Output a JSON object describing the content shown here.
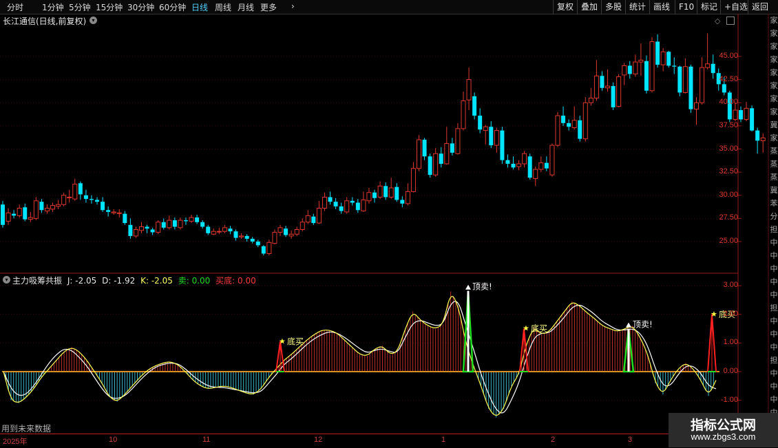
{
  "toolbar": {
    "periods": [
      "分时",
      "1分钟",
      "5分钟",
      "15分钟",
      "30分钟",
      "60分钟",
      "日线",
      "周线",
      "月线",
      "更多"
    ],
    "active_index": 6,
    "more_arrow": "›",
    "right_items": [
      "复权",
      "叠加",
      "多股",
      "统计",
      "画线",
      "F10",
      "标记",
      "+自选",
      "返回"
    ]
  },
  "stock_title": "长江通信(日线,前复权)",
  "price_axis": [
    "45.00",
    "42.50",
    "40.00",
    "37.50",
    "35.00",
    "32.50",
    "30.00",
    "27.50",
    "25.00"
  ],
  "indicator": {
    "name": "主力吸筹共振",
    "j": "J: -2.05",
    "d": "D: -1.92",
    "k": "K: -2.05",
    "sell_label": "卖:",
    "sell_value": "0.00",
    "buy_label": "买底:",
    "buy_value": "0.00",
    "axis": [
      "3.00",
      "2.00",
      "1.00",
      "0.00",
      "-1.00"
    ],
    "signals": [
      {
        "text": "底买",
        "kind": "buy"
      },
      {
        "text": "顶卖!",
        "kind": "sell"
      },
      {
        "text": "底买",
        "kind": "buy"
      },
      {
        "text": "顶卖!",
        "kind": "sell"
      },
      {
        "text": "底买",
        "kind": "buy"
      }
    ]
  },
  "right_strip": [
    "家",
    "家",
    "家",
    "家",
    "家",
    "家",
    "家",
    "家",
    "冀",
    "家",
    "蒸",
    "蒸",
    "蒸",
    "冀",
    "苯",
    "分",
    "担",
    "中",
    "中",
    "中",
    "中",
    "中",
    "担",
    "中",
    "中",
    "中",
    "担",
    "中",
    "中",
    "中",
    "中"
  ],
  "future_note": "用到未来数据",
  "dates": [
    "2025年",
    "10",
    "11",
    "12",
    "1",
    "2",
    "3"
  ],
  "watermark": {
    "title": "指标公式网",
    "url": "www.zbgs3.com"
  },
  "colors": {
    "up": "#e0382e",
    "down": "#00e5ff",
    "grid": "#7a1010",
    "active": "#4fd0ff"
  },
  "chart_data": [
    {
      "type": "candlestick",
      "title": "长江通信(日线,前复权)",
      "y_axis_ticks": [
        25.0,
        27.5,
        30.0,
        32.5,
        35.0,
        37.5,
        40.0,
        42.5,
        45.0
      ],
      "x_ticks": [
        "2025年",
        "10",
        "11",
        "12",
        "1",
        "2",
        "3"
      ],
      "candles": [
        [
          29,
          26.8,
          29.4,
          26.5
        ],
        [
          27.2,
          28.1,
          28.6,
          26.8
        ],
        [
          28,
          27.8,
          28.4,
          27.5
        ],
        [
          27.8,
          28.6,
          29,
          27.6
        ],
        [
          28.7,
          27.4,
          29.1,
          27.2
        ],
        [
          27.4,
          27.6,
          28.2,
          27.1
        ],
        [
          27.5,
          29.4,
          29.8,
          27.3
        ],
        [
          29.3,
          28.4,
          29.6,
          28.1
        ],
        [
          28.3,
          28.6,
          29,
          28
        ],
        [
          28.5,
          28.9,
          29.2,
          28.2
        ],
        [
          28.8,
          29,
          29.5,
          28.5
        ],
        [
          29,
          30,
          30.3,
          28.8
        ],
        [
          29.8,
          29.8,
          30.6,
          29.2
        ],
        [
          29.6,
          31.2,
          31.8,
          29.4
        ],
        [
          31.3,
          30.1,
          31.5,
          29.5
        ],
        [
          30,
          29.6,
          30.6,
          29.2
        ],
        [
          29.6,
          29.5,
          30,
          29.1
        ],
        [
          29.5,
          29.3,
          29.8,
          29
        ],
        [
          29.3,
          28.4,
          29.8,
          28.2
        ],
        [
          28.4,
          28.2,
          28.8,
          27.7
        ],
        [
          28.1,
          28.2,
          28.5,
          27.9
        ],
        [
          28.1,
          28.1,
          28.5,
          27.6
        ],
        [
          28,
          27,
          28.3,
          26.8
        ],
        [
          26.8,
          25.6,
          27.5,
          25.3
        ],
        [
          25.6,
          26.3,
          26.6,
          25.4
        ],
        [
          26.2,
          26.6,
          27.1,
          25.9
        ],
        [
          26.6,
          26.4,
          26.8,
          25.9
        ],
        [
          26.3,
          26,
          26.5,
          25.7
        ],
        [
          26,
          27.1,
          27.3,
          25.8
        ],
        [
          27.1,
          26.5,
          27.5,
          26.3
        ],
        [
          26.5,
          27.3,
          27.8,
          26.3
        ],
        [
          27.3,
          26.6,
          27.6,
          26.3
        ],
        [
          26.5,
          27.3,
          27.6,
          26.3
        ],
        [
          27.3,
          27.2,
          27.6,
          26.8
        ],
        [
          27.2,
          27.6,
          27.9,
          27
        ],
        [
          27.6,
          27.1,
          27.9,
          26.9
        ],
        [
          27.1,
          26.6,
          27.3,
          26.4
        ],
        [
          26.6,
          25.9,
          26.8,
          25.7
        ],
        [
          25.8,
          26.1,
          26.4,
          25.7
        ],
        [
          26.1,
          26.1,
          26.5,
          25.8
        ],
        [
          26.1,
          26.5,
          26.8,
          25.9
        ],
        [
          26.4,
          26.1,
          26.7,
          25.8
        ],
        [
          26.1,
          25.4,
          26.3,
          25.1
        ],
        [
          25.5,
          25.6,
          25.9,
          25.3
        ],
        [
          25.6,
          25.3,
          25.8,
          25
        ],
        [
          25.3,
          25,
          25.5,
          24.8
        ],
        [
          25,
          24.6,
          25.2,
          24.4
        ],
        [
          24.5,
          23.7,
          24.6,
          23.5
        ],
        [
          23.7,
          24.9,
          25.2,
          23.5
        ],
        [
          24.8,
          26,
          26.3,
          24.7
        ],
        [
          26,
          26.5,
          26.8,
          25.6
        ],
        [
          26.4,
          25.7,
          26.7,
          25.5
        ],
        [
          25.6,
          25.8,
          26.2,
          25.3
        ],
        [
          25.8,
          26.3,
          26.6,
          25.6
        ],
        [
          26.3,
          27.1,
          27.5,
          26.1
        ],
        [
          27.1,
          27.8,
          28.4,
          26.9
        ],
        [
          27.7,
          27,
          28,
          26.8
        ],
        [
          27,
          28.6,
          29.4,
          26.9
        ],
        [
          28.6,
          29.8,
          30.3,
          28.3
        ],
        [
          29.8,
          29.3,
          30.4,
          29
        ],
        [
          29.3,
          28.8,
          29.7,
          28.5
        ],
        [
          28.8,
          28.3,
          29.2,
          28
        ],
        [
          28.2,
          29.4,
          29.8,
          28
        ],
        [
          29.4,
          29.2,
          29.8,
          28.9
        ],
        [
          29.2,
          28.4,
          29.6,
          28.1
        ],
        [
          28.3,
          29.5,
          30.4,
          28.2
        ],
        [
          29.4,
          30.3,
          30.8,
          29.1
        ],
        [
          30.3,
          29.7,
          30.6,
          29.2
        ],
        [
          29.8,
          31,
          31.5,
          29.6
        ],
        [
          31,
          29.8,
          31.4,
          29.5
        ],
        [
          29.8,
          30.8,
          31.9,
          29.6
        ],
        [
          30.9,
          29.5,
          31.3,
          29.3
        ],
        [
          29.5,
          29.1,
          29.9,
          28.7
        ],
        [
          29.1,
          30.4,
          31.3,
          28.9
        ],
        [
          30.4,
          32.9,
          33.6,
          30.3
        ],
        [
          32.9,
          36,
          36.5,
          32.6
        ],
        [
          36,
          34.2,
          36.2,
          33.8
        ],
        [
          34.2,
          32.2,
          34.5,
          31.9
        ],
        [
          32.2,
          34.5,
          35.1,
          32
        ],
        [
          34.5,
          33.4,
          35.2,
          33
        ],
        [
          33.4,
          35.6,
          37.4,
          33.3
        ],
        [
          35.6,
          34.6,
          36.2,
          34.3
        ],
        [
          34.5,
          37.2,
          37.8,
          34.4
        ],
        [
          37.2,
          40.2,
          41.2,
          37
        ],
        [
          40.3,
          42.5,
          43.8,
          39.2
        ],
        [
          40.7,
          38.6,
          41.1,
          38.2
        ],
        [
          38.6,
          37.1,
          39.4,
          36.7
        ],
        [
          37,
          37.4,
          37.6,
          35.5
        ],
        [
          37.4,
          35.4,
          38,
          35.1
        ],
        [
          35.4,
          37,
          37.3,
          34.6
        ],
        [
          37,
          33.8,
          37.4,
          33.4
        ],
        [
          33.8,
          33.4,
          34.4,
          33
        ],
        [
          33.4,
          33,
          34.2,
          32.8
        ],
        [
          33.1,
          33.4,
          33.8,
          32.7
        ],
        [
          33.4,
          34.5,
          34.8,
          33
        ],
        [
          34.2,
          31.9,
          34.5,
          31.7
        ],
        [
          31.8,
          32.8,
          33.1,
          31
        ],
        [
          32.8,
          33.5,
          34.2,
          32.5
        ],
        [
          33.5,
          32.9,
          34.2,
          32.6
        ],
        [
          32.2,
          35.4,
          35.6,
          32
        ],
        [
          35.4,
          38.6,
          39,
          35.2
        ],
        [
          38.6,
          37.8,
          39.6,
          37.5
        ],
        [
          37.8,
          37.4,
          38.2,
          37
        ],
        [
          37.3,
          38.1,
          39.6,
          37.1
        ],
        [
          38.1,
          36.1,
          38.6,
          35.8
        ],
        [
          36.1,
          40,
          40.6,
          35.8
        ],
        [
          40,
          40.5,
          41.6,
          39.7
        ],
        [
          40.5,
          42.9,
          44.6,
          40.2
        ],
        [
          42.9,
          41.6,
          43.4,
          41.3
        ],
        [
          41.6,
          41.8,
          43.6,
          41.2
        ],
        [
          41.8,
          39.5,
          42.2,
          39.2
        ],
        [
          39.6,
          42.8,
          43.1,
          39.5
        ],
        [
          43,
          44,
          44.3,
          41.9
        ],
        [
          44,
          43.1,
          44.5,
          42.6
        ],
        [
          43.1,
          44.4,
          45.2,
          42.8
        ],
        [
          44.4,
          44.6,
          46.4,
          42.9
        ],
        [
          44.5,
          41.3,
          45.1,
          41
        ],
        [
          41.3,
          46.6,
          47.1,
          41.1
        ],
        [
          46.6,
          44.1,
          47.4,
          43.8
        ],
        [
          44.1,
          45.5,
          45.9,
          43.4
        ],
        [
          45.5,
          44,
          45.6,
          43.8
        ],
        [
          44,
          43.9,
          44.9,
          43.1
        ],
        [
          43.9,
          41.1,
          44,
          40.7
        ],
        [
          41.1,
          43.9,
          44.8,
          41
        ],
        [
          43.9,
          39.3,
          44.1,
          38.9
        ],
        [
          39.3,
          40,
          40.6,
          37.6
        ],
        [
          40,
          43.8,
          44.9,
          39.8
        ],
        [
          43.8,
          44.2,
          47.5,
          43.6
        ],
        [
          44.2,
          43.2,
          45.2,
          42.6
        ],
        [
          43.2,
          42,
          43.7,
          41.3
        ],
        [
          42,
          41.1,
          42.8,
          40.8
        ],
        [
          41.1,
          38.2,
          41.3,
          37.9
        ],
        [
          38.2,
          39.2,
          40,
          38
        ],
        [
          39.2,
          38.2,
          39.6,
          37.9
        ],
        [
          38.2,
          39.4,
          40.1,
          38
        ],
        [
          39.4,
          37,
          39.7,
          36.9
        ],
        [
          37,
          35.9,
          37.3,
          34.5
        ],
        [
          35.9,
          36.2,
          36.7,
          34.6
        ]
      ]
    },
    {
      "type": "line",
      "title": "主力吸筹共振",
      "y_axis_ticks": [
        -1.0,
        0.0,
        1.0,
        2.0,
        3.0
      ],
      "series": [
        {
          "name": "J",
          "color": "#ffff55"
        },
        {
          "name": "D",
          "color": "#ffffff"
        },
        {
          "name": "K",
          "color": "#ffffcc"
        }
      ],
      "fast": [
        0,
        -1,
        -1.1,
        -0.9,
        -0.6,
        -0.2,
        0.1,
        0.4,
        0.7,
        0.85,
        0.7,
        0.4,
        0,
        -0.4,
        -0.9,
        -1.05,
        -0.8,
        -0.5,
        -0.2,
        0.05,
        0.2,
        0.3,
        0.35,
        0.25,
        0,
        -0.3,
        -0.5,
        -0.6,
        -0.55,
        -0.5,
        -0.55,
        -0.65,
        -0.75,
        -0.8,
        -0.6,
        -0.2,
        0.1,
        0.4,
        0.6,
        0.85,
        1.1,
        1.3,
        1.45,
        1.45,
        1.35,
        1.1,
        0.85,
        0.6,
        0.55,
        0.8,
        0.9,
        0.6,
        0.7,
        1.5,
        2.1,
        1.8,
        1.6,
        1.5,
        1.65,
        2.8,
        2.3,
        1.0,
        0.2,
        -0.5,
        -1.3,
        -1.6,
        -1.3,
        -0.5,
        -0.1,
        1.0,
        1.55,
        1.3,
        1.4,
        1.75,
        2.1,
        2.45,
        2.3,
        2.05,
        1.85,
        1.6,
        1.5,
        1.4,
        1.5,
        1.6,
        1.2,
        0.6,
        -0.4,
        -0.8,
        -0.3,
        0.1,
        0.3,
        0.1,
        -0.3,
        -0.85,
        -0.3
      ],
      "slow": [
        0,
        -0.6,
        -0.85,
        -0.8,
        -0.5,
        -0.1,
        0.3,
        0.6,
        0.8,
        0.75,
        0.5,
        0.2,
        -0.2,
        -0.6,
        -0.9,
        -0.95,
        -0.85,
        -0.6,
        -0.3,
        -0.05,
        0.15,
        0.25,
        0.3,
        0.28,
        0.1,
        -0.15,
        -0.35,
        -0.5,
        -0.55,
        -0.55,
        -0.6,
        -0.65,
        -0.7,
        -0.75,
        -0.7,
        -0.4,
        -0.1,
        0.25,
        0.45,
        0.7,
        0.95,
        1.15,
        1.3,
        1.4,
        1.35,
        1.2,
        1.0,
        0.8,
        0.65,
        0.75,
        0.8,
        0.7,
        0.65,
        1.2,
        1.7,
        1.8,
        1.7,
        1.6,
        1.65,
        2.4,
        2.5,
        1.6,
        0.8,
        -0.1,
        -0.8,
        -1.35,
        -1.5,
        -1.0,
        -0.4,
        0.5,
        1.2,
        1.35,
        1.35,
        1.6,
        1.9,
        2.25,
        2.35,
        2.2,
        2.0,
        1.75,
        1.6,
        1.45,
        1.45,
        1.5,
        1.35,
        0.9,
        0.1,
        -0.5,
        -0.5,
        -0.1,
        0.2,
        0.2,
        -0.05,
        -0.5,
        -0.6
      ]
    }
  ]
}
